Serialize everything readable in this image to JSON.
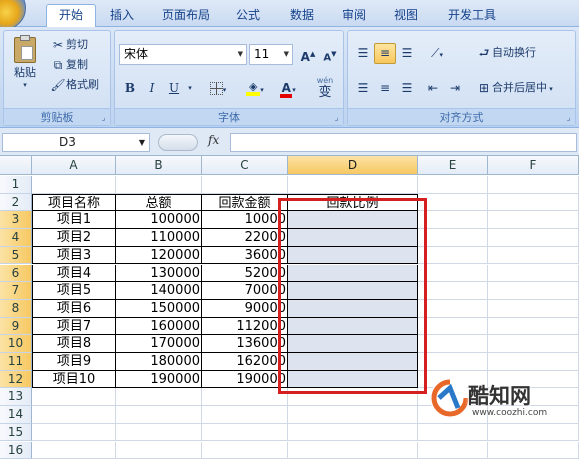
{
  "ribbon_tabs": [
    "开始",
    "插入",
    "页面布局",
    "公式",
    "数据",
    "审阅",
    "视图",
    "开发工具"
  ],
  "clipboard": {
    "paste": "粘贴",
    "cut": "剪切",
    "copy": "复制",
    "format_painter": "格式刷",
    "group_label": "剪贴板"
  },
  "font": {
    "name": "宋体",
    "size": "11",
    "grow": "A",
    "shrink": "A",
    "bold": "B",
    "italic": "I",
    "underline": "U",
    "color_letter": "A",
    "phonetic": "wén",
    "phonetic_char": "变",
    "group_label": "字体"
  },
  "alignment": {
    "wrap_text": "自动换行",
    "merge_center": "合并后居中",
    "group_label": "对齐方式"
  },
  "formula_bar": {
    "name_box": "D3",
    "fx": "fx",
    "formula": ""
  },
  "columns": [
    "A",
    "B",
    "C",
    "D",
    "E",
    "F"
  ],
  "selected_column": "D",
  "rows": [
    "1",
    "2",
    "3",
    "4",
    "5",
    "6",
    "7",
    "8",
    "9",
    "10",
    "11",
    "12",
    "13",
    "14",
    "15",
    "16"
  ],
  "headers": [
    "项目名称",
    "总额",
    "回款金额",
    "回款比例"
  ],
  "table_rows": [
    {
      "name": "项目1",
      "total": "100000",
      "received": "10000",
      "ratio": ""
    },
    {
      "name": "项目2",
      "total": "110000",
      "received": "22000",
      "ratio": ""
    },
    {
      "name": "项目3",
      "total": "120000",
      "received": "36000",
      "ratio": ""
    },
    {
      "name": "项目4",
      "total": "130000",
      "received": "52000",
      "ratio": ""
    },
    {
      "name": "项目5",
      "total": "140000",
      "received": "70000",
      "ratio": ""
    },
    {
      "name": "项目6",
      "total": "150000",
      "received": "90000",
      "ratio": ""
    },
    {
      "name": "项目7",
      "total": "160000",
      "received": "112000",
      "ratio": ""
    },
    {
      "name": "项目8",
      "total": "170000",
      "received": "136000",
      "ratio": ""
    },
    {
      "name": "项目9",
      "total": "180000",
      "received": "162000",
      "ratio": ""
    },
    {
      "name": "项目10",
      "total": "190000",
      "received": "190000",
      "ratio": ""
    }
  ],
  "watermark": {
    "brand": "酷知网",
    "url": "www.coozhi.com"
  },
  "colors": {
    "selection_highlight": "#dde4ef",
    "annotation_red": "#d42020",
    "ribbon_text": "#15428b"
  }
}
